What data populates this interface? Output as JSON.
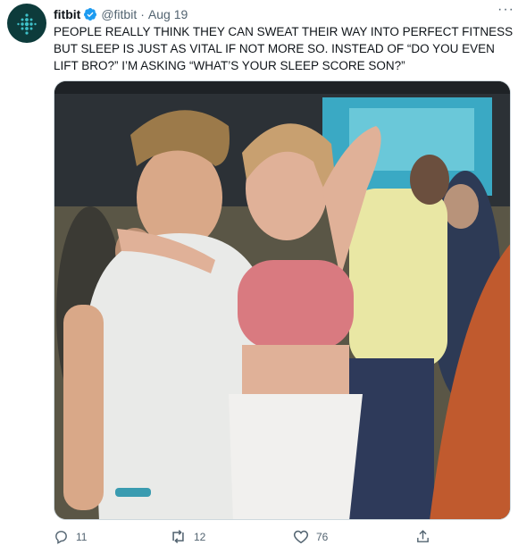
{
  "tweet": {
    "author_name": "fitbit",
    "handle": "@fitbit",
    "separator": "·",
    "date": "Aug 19",
    "more_label": "···",
    "text_lines": [
      "PEOPLE REALLY THINK THEY CAN SWEAT THEIR WAY INTO PERFECT FITNESS",
      "BUT SLEEP IS JUST AS VITAL IF NOT MORE SO. INSTEAD OF “DO YOU EVEN",
      "LIFT BRO?” I’M ASKING “WHAT’S YOUR SLEEP SCORE SON?”"
    ],
    "icons": {
      "avatar": "fitbit-logo-icon",
      "verified": "verified-badge-icon",
      "reply": "reply-icon",
      "retweet": "retweet-icon",
      "like": "heart-icon",
      "share": "share-icon"
    },
    "counts": {
      "replies": "11",
      "retweets": "12",
      "likes": "76"
    },
    "colors": {
      "verified": "#1d9bf0",
      "text_secondary": "#536471",
      "avatar_bg": "#0d3b3b",
      "avatar_dots": "#3fc1c9"
    }
  }
}
